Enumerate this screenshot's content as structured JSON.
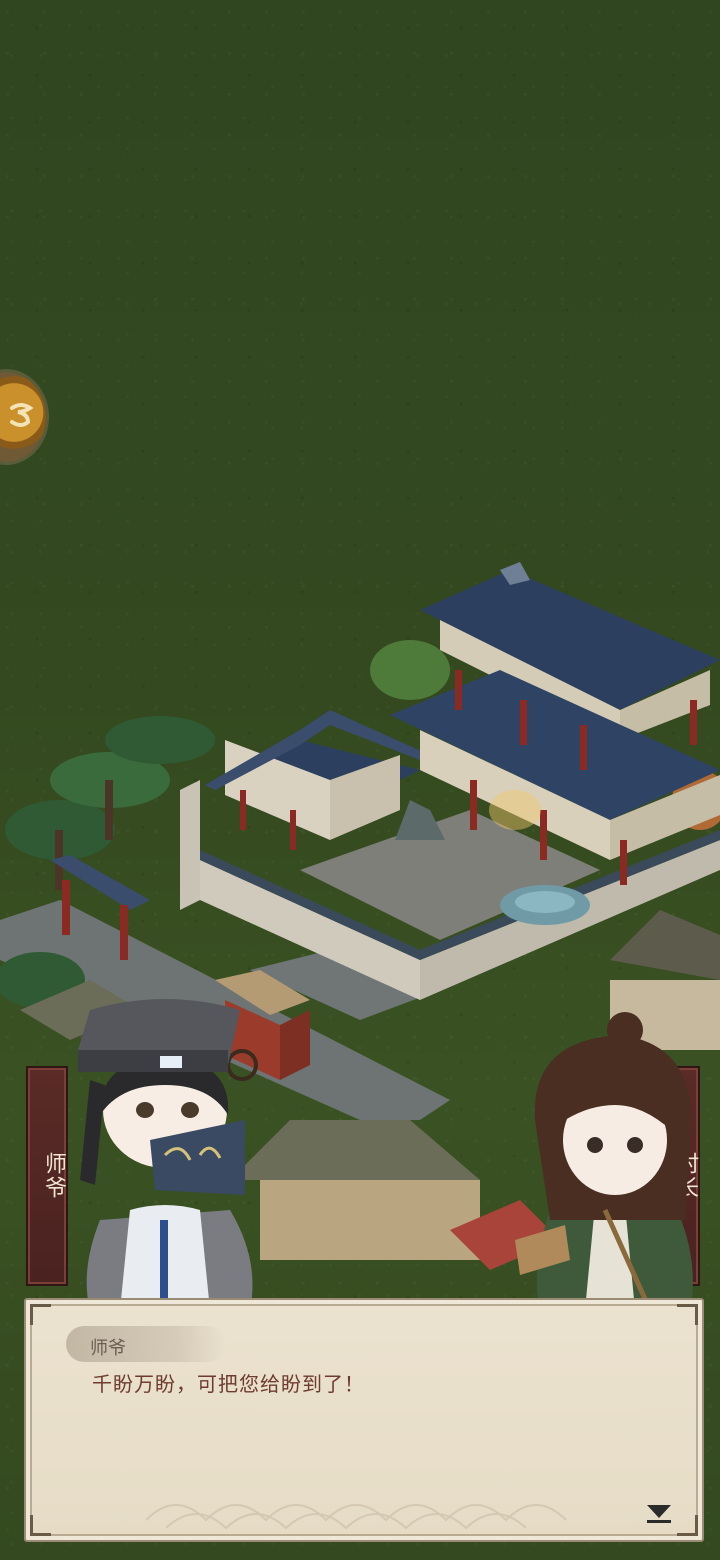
{
  "dialog": {
    "speaker": "师爷",
    "text": "千盼万盼，可把您给盼到了！"
  },
  "nameplates": {
    "left": "师爷",
    "right": "村长"
  },
  "icons": {
    "side_button": "gold-coin-icon",
    "advance": "triangle-down-icon"
  },
  "colors": {
    "grass": "#34491f",
    "roof": "#2c3f5e",
    "pillar": "#8a2a22",
    "dialog_bg": "#e8dfcb",
    "dialog_text": "#6e3b2e",
    "nameplate": "#5a2b27"
  }
}
